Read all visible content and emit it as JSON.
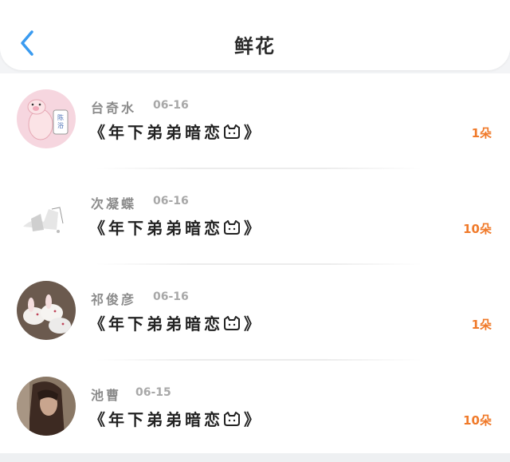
{
  "header": {
    "title": "鲜花",
    "back_icon": "chevron-left-icon",
    "back_color": "#3a9bf0"
  },
  "records": [
    {
      "name": "台奇水",
      "date": "06-16",
      "book_open": "《年下弟弟暗恋",
      "book_close": "》",
      "count": "1朵",
      "avatar": "pig-cartoon-avatar"
    },
    {
      "name": "次凝蝶",
      "date": "06-16",
      "book_open": "《年下弟弟暗恋",
      "book_close": "》",
      "count": "10朵",
      "avatar": "sketch-avatar"
    },
    {
      "name": "祁俊彦",
      "date": "06-16",
      "book_open": "《年下弟弟暗恋",
      "book_close": "》",
      "count": "1朵",
      "avatar": "rabbits-avatar"
    },
    {
      "name": "池曹",
      "date": "06-15",
      "book_open": "《年下弟弟暗恋",
      "book_close": "》",
      "count": "10朵",
      "avatar": "girl-photo-avatar"
    }
  ],
  "colors": {
    "count": "#f07a2a",
    "title": "#2b2b2b"
  }
}
